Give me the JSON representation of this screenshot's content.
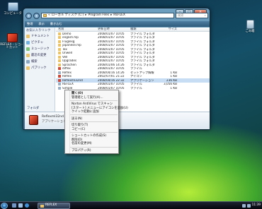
{
  "desktop_icons": [
    {
      "label": "コンピュータ",
      "icon": "computer-icon",
      "color": "#8fb6d8"
    },
    {
      "label": "REFLEX - ショートカット",
      "icon": "reflex-shortcut-icon",
      "color": "#d7341d"
    },
    {
      "label": "ごみ箱",
      "icon": "recycle-bin-icon",
      "color": "#c9dce8"
    }
  ],
  "explorer": {
    "address": {
      "segment1": "ローカル ディスク (C:)",
      "segment2": "Program Files",
      "segment3": "REFLEX"
    },
    "search_placeholder": "検索",
    "toolbar": {
      "organize": "整理",
      "views": "表示",
      "burn": "書き込む"
    },
    "sidebar": {
      "header": "お気に入りリンク",
      "items": [
        {
          "label": "ドキュメント",
          "color": "#e9c46a"
        },
        {
          "label": "ピクチャ",
          "color": "#6fb1e0"
        },
        {
          "label": "ミュージック",
          "color": "#7cc37a"
        },
        {
          "label": "最近の変更",
          "color": "#e9c46a"
        },
        {
          "label": "検索",
          "color": "#8aa7c2"
        },
        {
          "label": "パブリック",
          "color": "#e9c46a"
        }
      ],
      "footer": "フォルダ"
    },
    "columns": [
      "名前",
      "更新日時",
      "種類",
      "サイズ"
    ],
    "files": [
      {
        "name": "Demo",
        "date": "2008/01/07 10:05",
        "type": "ファイル フォルダ",
        "size": "",
        "color": "#e9c46a"
      },
      {
        "name": "english.hlp",
        "date": "2008/01/07 10:05",
        "type": "ファイル フォルダ",
        "size": "",
        "color": "#e9c46a"
      },
      {
        "name": "Fluglesg",
        "date": "2008/01/07 10:05",
        "type": "ファイル フォルダ",
        "size": "",
        "color": "#e9c46a"
      },
      {
        "name": "japanese.hlp",
        "date": "2008/01/07 10:05",
        "type": "ファイル フォルダ",
        "size": "",
        "color": "#e9c46a"
      },
      {
        "name": "Tex",
        "date": "2008/01/07 10:05",
        "type": "ファイル フォルダ",
        "size": "",
        "color": "#e9c46a"
      },
      {
        "name": "Unwell",
        "date": "2008/01/07 10:05",
        "type": "ファイル フォルダ",
        "size": "",
        "color": "#e9c46a"
      },
      {
        "name": "Vell",
        "date": "2008/01/07 10:05",
        "type": "ファイル フォルダ",
        "size": "",
        "color": "#e9c46a"
      },
      {
        "name": "Upgrades",
        "date": "2008/01/07 10:05",
        "type": "ファイル フォルダ",
        "size": "",
        "color": "#e9c46a"
      },
      {
        "name": "Sprachen",
        "date": "2008/01/06 14:26",
        "type": "ファイル フォルダ",
        "size": "",
        "color": "#e9c46a"
      },
      {
        "name": "diffex",
        "date": "2008/01/07 10:05",
        "type": "ファイル",
        "size": "",
        "color": "#c94a3a"
      },
      {
        "name": "Reflex",
        "date": "2008/04/16 14:26",
        "type": "セットアップ情報",
        "size": "1 KB",
        "color": "#9ab0c4"
      },
      {
        "name": "Reflex",
        "date": "2002/07/01 21:22",
        "type": "アイコン",
        "size": "1 KB",
        "color": "#c94a3a"
      },
      {
        "name": "Reflexml32nd",
        "date": "2008/04/16 22:32",
        "type": "アプリケーション",
        "size": "236 KB",
        "color": "#c94a3a",
        "selected": true
      },
      {
        "name": "REFLEX",
        "date": "2008/01/07 10:05",
        "type": "ファイル",
        "size": "3,056 KB",
        "color": "#9ab0c4"
      },
      {
        "name": "Simple",
        "date": "2008/01/07 10:05",
        "type": "ファイル",
        "size": "1 KB",
        "color": "#9ab0c4"
      }
    ],
    "details": {
      "name": "Reflexml32nd",
      "type": "アプリケーション"
    }
  },
  "context_menu": {
    "items": [
      {
        "label": "開く(O)",
        "bold": true
      },
      {
        "label": "管理者として実行(A)..."
      },
      {
        "label": "Norton AntiVirus でスキャン"
      },
      {
        "label": "[スタート] メニューにアイコンを追加(U)"
      },
      {
        "label": "クイック起動に追加"
      },
      {
        "label": "送る(N)"
      },
      {
        "label": "切り取り(T)"
      },
      {
        "label": "コピー(C)"
      },
      {
        "label": "ショートカットの作成(S)"
      },
      {
        "label": "削除(D)"
      },
      {
        "label": "名前の変更(M)"
      },
      {
        "label": "プロパティ(R)"
      }
    ]
  },
  "taskbar": {
    "window_button": "REFLEX",
    "clock": "11:39"
  }
}
